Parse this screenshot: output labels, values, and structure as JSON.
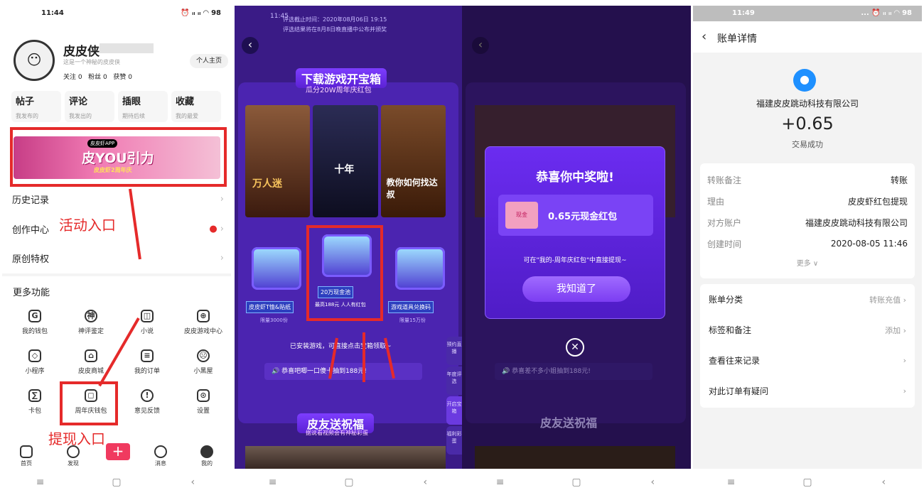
{
  "panel1": {
    "status": {
      "time": "11:44",
      "icons": "⏰ ᵢₗ ᵢₗ ◠ 98"
    },
    "profile": {
      "name": "皮皮侠",
      "bio": "这是一个神秘的皮皮侠",
      "stats": "关注 0   粉丝 0   获赞 0",
      "homepage_btn": "个人主页"
    },
    "tiles": [
      {
        "t": "帖子",
        "s": "我发布的"
      },
      {
        "t": "评论",
        "s": "我发出的"
      },
      {
        "t": "插眼",
        "s": "期待后续"
      },
      {
        "t": "收藏",
        "s": "我的最爱"
      }
    ],
    "banner": {
      "app": "皮皮虾APP",
      "main": "皮YOU引力",
      "sub": "皮皮虾2周年庆"
    },
    "rows": [
      {
        "label": "历史记录"
      },
      {
        "label": "创作中心"
      },
      {
        "label": "原创特权"
      }
    ],
    "more_title": "更多功能",
    "grid": [
      {
        "label": "我的钱包",
        "icon": "wallet-icon",
        "g": "G"
      },
      {
        "label": "神评鉴定",
        "icon": "god-icon",
        "g": "神"
      },
      {
        "label": "小说",
        "icon": "book-icon",
        "g": "◫"
      },
      {
        "label": "皮皮游戏中心",
        "icon": "gamepad-icon",
        "g": "⊕"
      },
      {
        "label": "小程序",
        "icon": "link-icon",
        "g": "◇"
      },
      {
        "label": "皮皮商城",
        "icon": "shop-icon",
        "g": "⌂"
      },
      {
        "label": "我的订单",
        "icon": "order-icon",
        "g": "≡"
      },
      {
        "label": "小黑屋",
        "icon": "ban-icon",
        "g": "☹"
      },
      {
        "label": "卡包",
        "icon": "card-icon",
        "g": "∑"
      },
      {
        "label": "周年庆钱包",
        "icon": "cylinder-icon",
        "g": "◻"
      },
      {
        "label": "意见反馈",
        "icon": "feedback-icon",
        "g": "!"
      },
      {
        "label": "设置",
        "icon": "settings-icon",
        "g": "⊙"
      }
    ],
    "tabs": [
      {
        "label": "首页"
      },
      {
        "label": "发现"
      },
      {
        "label": "+"
      },
      {
        "label": "消息"
      },
      {
        "label": "我的"
      }
    ],
    "annot_activity": "活动入口",
    "annot_withdraw": "提现入口"
  },
  "panel2": {
    "top_note1": "评选截止时间：2020年08月06日 19:15",
    "top_note2": "评选结果将在8月8日晚直播中公布并颁奖",
    "status_time": "11:45",
    "title": "下载游戏开宝箱",
    "subtitle": "瓜分20W周年庆红包",
    "cover_texts": [
      "万人迷",
      "十年",
      "教你如何找达叔"
    ],
    "chests": [
      {
        "label": "皮皮虾T恤&贴纸",
        "note": "限量3000份"
      },
      {
        "label": "20万现金池",
        "note": "最高188元 人人有红包"
      },
      {
        "label": "游戏道具兑换码",
        "note": "限量15万份"
      }
    ],
    "installed": "已安装游戏，可直接点击宝箱领取~",
    "broadcast": "恭喜吧唧一口傻十抽到188元!",
    "side": [
      "预约直播",
      "年度评选",
      "开启宝箱",
      "福利彩蛋"
    ],
    "section2": "皮友送祝福",
    "section2_sub": "据说看视频会有神秘彩蛋"
  },
  "panel3": {
    "popup_title": "恭喜你中奖啦!",
    "prize_tag": "现金",
    "prize": "0.65元现金红包",
    "hint": "可在\"我的-周年庆红包\"中直接提现~",
    "ok_btn": "我知道了",
    "broadcast": "恭喜差不多小姐抽到188元!"
  },
  "panel4": {
    "status": {
      "time": "11:49",
      "icons": "... ⏰ ᵢₗ ᵢₗ ◠ 98"
    },
    "title": "账单详情",
    "company": "福建皮皮跳动科技有限公司",
    "amount": "+0.65",
    "result": "交易成功",
    "details": [
      {
        "k": "转账备注",
        "v": "转账"
      },
      {
        "k": "理由",
        "v": "皮皮虾红包提现"
      },
      {
        "k": "对方账户",
        "v": "福建皮皮跳动科技有限公司"
      },
      {
        "k": "创建时间",
        "v": "2020-08-05 11:46"
      }
    ],
    "more": "更多 ∨",
    "menu": [
      {
        "k": "账单分类",
        "v": "转账充值"
      },
      {
        "k": "标签和备注",
        "v": "添加"
      },
      {
        "k": "查看往来记录",
        "v": ""
      },
      {
        "k": "对此订单有疑问",
        "v": ""
      }
    ]
  },
  "android_nav": [
    "≡",
    "▢",
    "‹"
  ]
}
